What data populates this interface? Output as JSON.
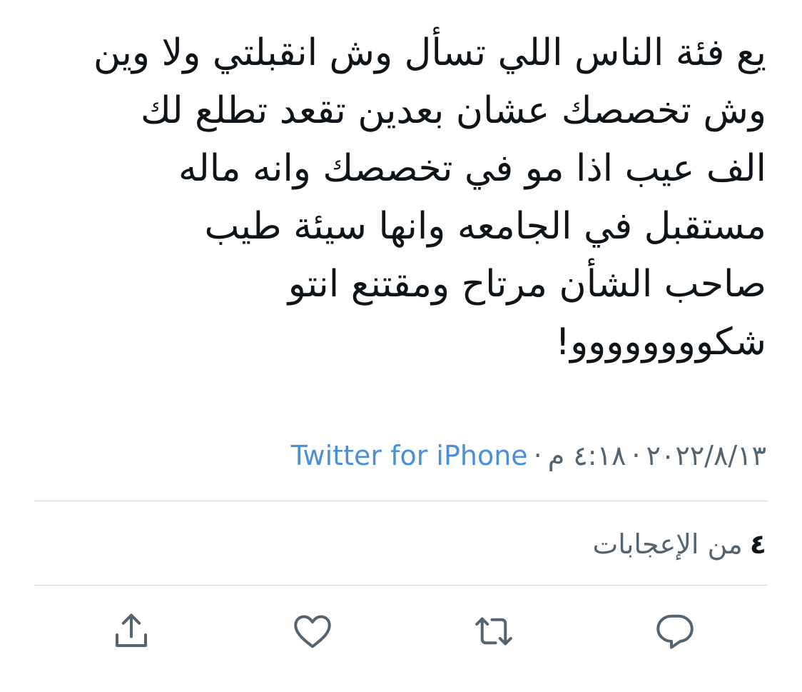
{
  "tweet": {
    "lines": [
      "يع فئة الناس اللي تسأل وش انقبلتي ولا وين",
      "وش تخصصك عشان بعدين تقعد تطلع لك",
      "الف عيب اذا مو في تخصصك وانه ماله",
      "مستقبل في الجامعه وانها سيئة طيب",
      "صاحب الشأن مرتاح ومقتنع انتو",
      "شكوووووووو!"
    ]
  },
  "meta": {
    "date": "٢٠٢٢/٨/١٣",
    "separator": "·",
    "time": "٤:١٨ م",
    "source": "Twitter for iPhone"
  },
  "stats": {
    "likes_count": "٤",
    "likes_label": "من الإعجابات"
  },
  "actions": {
    "reply_icon": "reply-icon",
    "retweet_icon": "retweet-icon",
    "like_icon": "heart-icon",
    "share_icon": "share-icon"
  },
  "colors": {
    "text": "#0f1419",
    "secondary": "#536471",
    "link": "#4a90d9",
    "divider": "#cfd9de",
    "icon": "#536471"
  }
}
